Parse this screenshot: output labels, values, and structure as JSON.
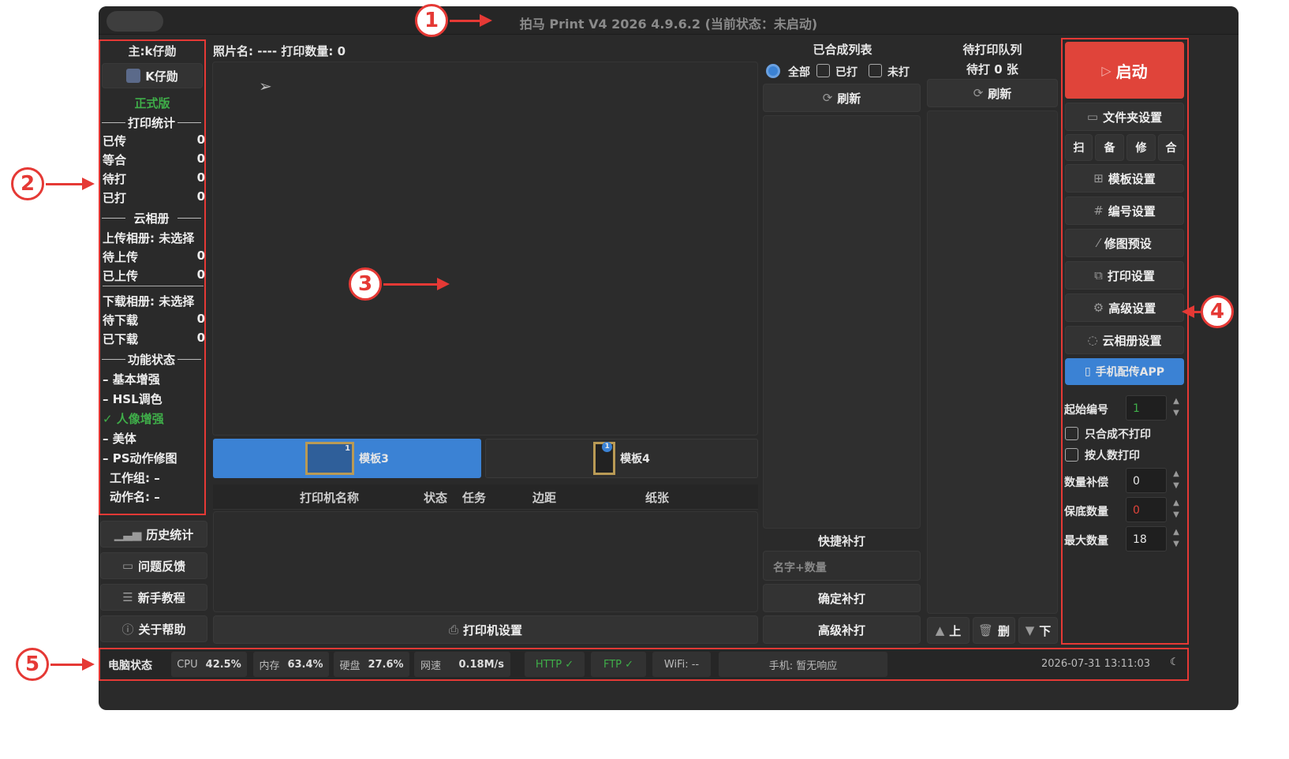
{
  "window": {
    "title": "拍马 Print V4 2026  4.9.6.2 (当前状态：未启动)"
  },
  "left": {
    "main_user": "主:k仔勋",
    "user_button": "K仔勋",
    "edition": "正式版",
    "print_stats_title": "打印统计",
    "print_stats": [
      {
        "label": "已传",
        "value": "0"
      },
      {
        "label": "等合",
        "value": "0"
      },
      {
        "label": "待打",
        "value": "0"
      },
      {
        "label": "已打",
        "value": "0"
      }
    ],
    "cloud_title": "云相册",
    "upload_album": "上传相册: 未选择",
    "upload_stats": [
      {
        "label": "待上传",
        "value": "0"
      },
      {
        "label": "已上传",
        "value": "0"
      }
    ],
    "download_album": "下载相册: 未选择",
    "download_stats": [
      {
        "label": "待下载",
        "value": "0"
      },
      {
        "label": "已下载",
        "value": "0"
      }
    ],
    "func_title": "功能状态",
    "features": [
      {
        "label": "– 基本增强"
      },
      {
        "label": "– HSL调色"
      },
      {
        "label": "✓ 人像增强",
        "active": true
      },
      {
        "label": "– 美体"
      },
      {
        "label": "– PS动作修图"
      }
    ],
    "workgroup": "工作组: –",
    "action_name": "动作名: –",
    "buttons": [
      {
        "label": "历史统计",
        "icon": "chart-icon"
      },
      {
        "label": "问题反馈",
        "icon": "chat-icon"
      },
      {
        "label": "新手教程",
        "icon": "doc-icon"
      },
      {
        "label": "关于帮助",
        "icon": "info-icon"
      }
    ]
  },
  "center": {
    "photo_name_label": "照片名: ---- 打印数量: 0",
    "templates": [
      {
        "label": "模板3",
        "badge": "1"
      },
      {
        "label": "模板4",
        "badge": "1"
      }
    ],
    "printer_table": {
      "headers": [
        "打印机名称",
        "状态",
        "任务",
        "边距",
        "纸张"
      ]
    },
    "printer_settings": "打印机设置"
  },
  "composed": {
    "title": "已合成列表",
    "filters": [
      "全部",
      "已打",
      "未打"
    ],
    "refresh": "刷新",
    "quick_title": "快捷补打",
    "quick_placeholder": "名字+数量",
    "confirm": "确定补打",
    "advanced": "高级补打"
  },
  "queue": {
    "title": "待打印队列",
    "count": "待打 0 张",
    "refresh": "刷新",
    "up": "上",
    "delete": "删",
    "down": "下"
  },
  "right": {
    "start": "启动",
    "folder": "文件夹设置",
    "small_buttons": [
      "扫",
      "备",
      "修",
      "合"
    ],
    "menu": [
      {
        "label": "模板设置",
        "icon": "grid-icon"
      },
      {
        "label": "编号设置",
        "icon": "hash-icon"
      },
      {
        "label": "修图预设",
        "icon": "wand-icon"
      },
      {
        "label": "打印设置",
        "icon": "copy-icon"
      },
      {
        "label": "高级设置",
        "icon": "gear-icon"
      },
      {
        "label": "云相册设置",
        "icon": "cloud-chat-icon"
      }
    ],
    "phone_app": "手机配传APP",
    "start_no_label": "起始编号",
    "start_no": "1",
    "only_compose": "只合成不打印",
    "by_people": "按人数打印",
    "qty_comp_label": "数量补偿",
    "qty_comp": "0",
    "min_qty_label": "保底数量",
    "min_qty": "0",
    "max_qty_label": "最大数量",
    "max_qty": "18"
  },
  "status": {
    "label": "电脑状态",
    "cpu_l": "CPU",
    "cpu": "42.5%",
    "mem_l": "内存",
    "mem": "63.4%",
    "disk_l": "硬盘",
    "disk": "27.6%",
    "net_l": "网速",
    "net": "0.18M/s",
    "http": "HTTP ✓",
    "ftp": "FTP ✓",
    "wifi": "WiFi: --",
    "phone": "手机: 暂无响应",
    "time": "2026-07-31 13:11:03"
  },
  "annotations": [
    "1",
    "2",
    "3",
    "4",
    "5"
  ],
  "colors": {
    "accent": "#e53935",
    "blue": "#3b82d4",
    "green": "#3fae49"
  }
}
